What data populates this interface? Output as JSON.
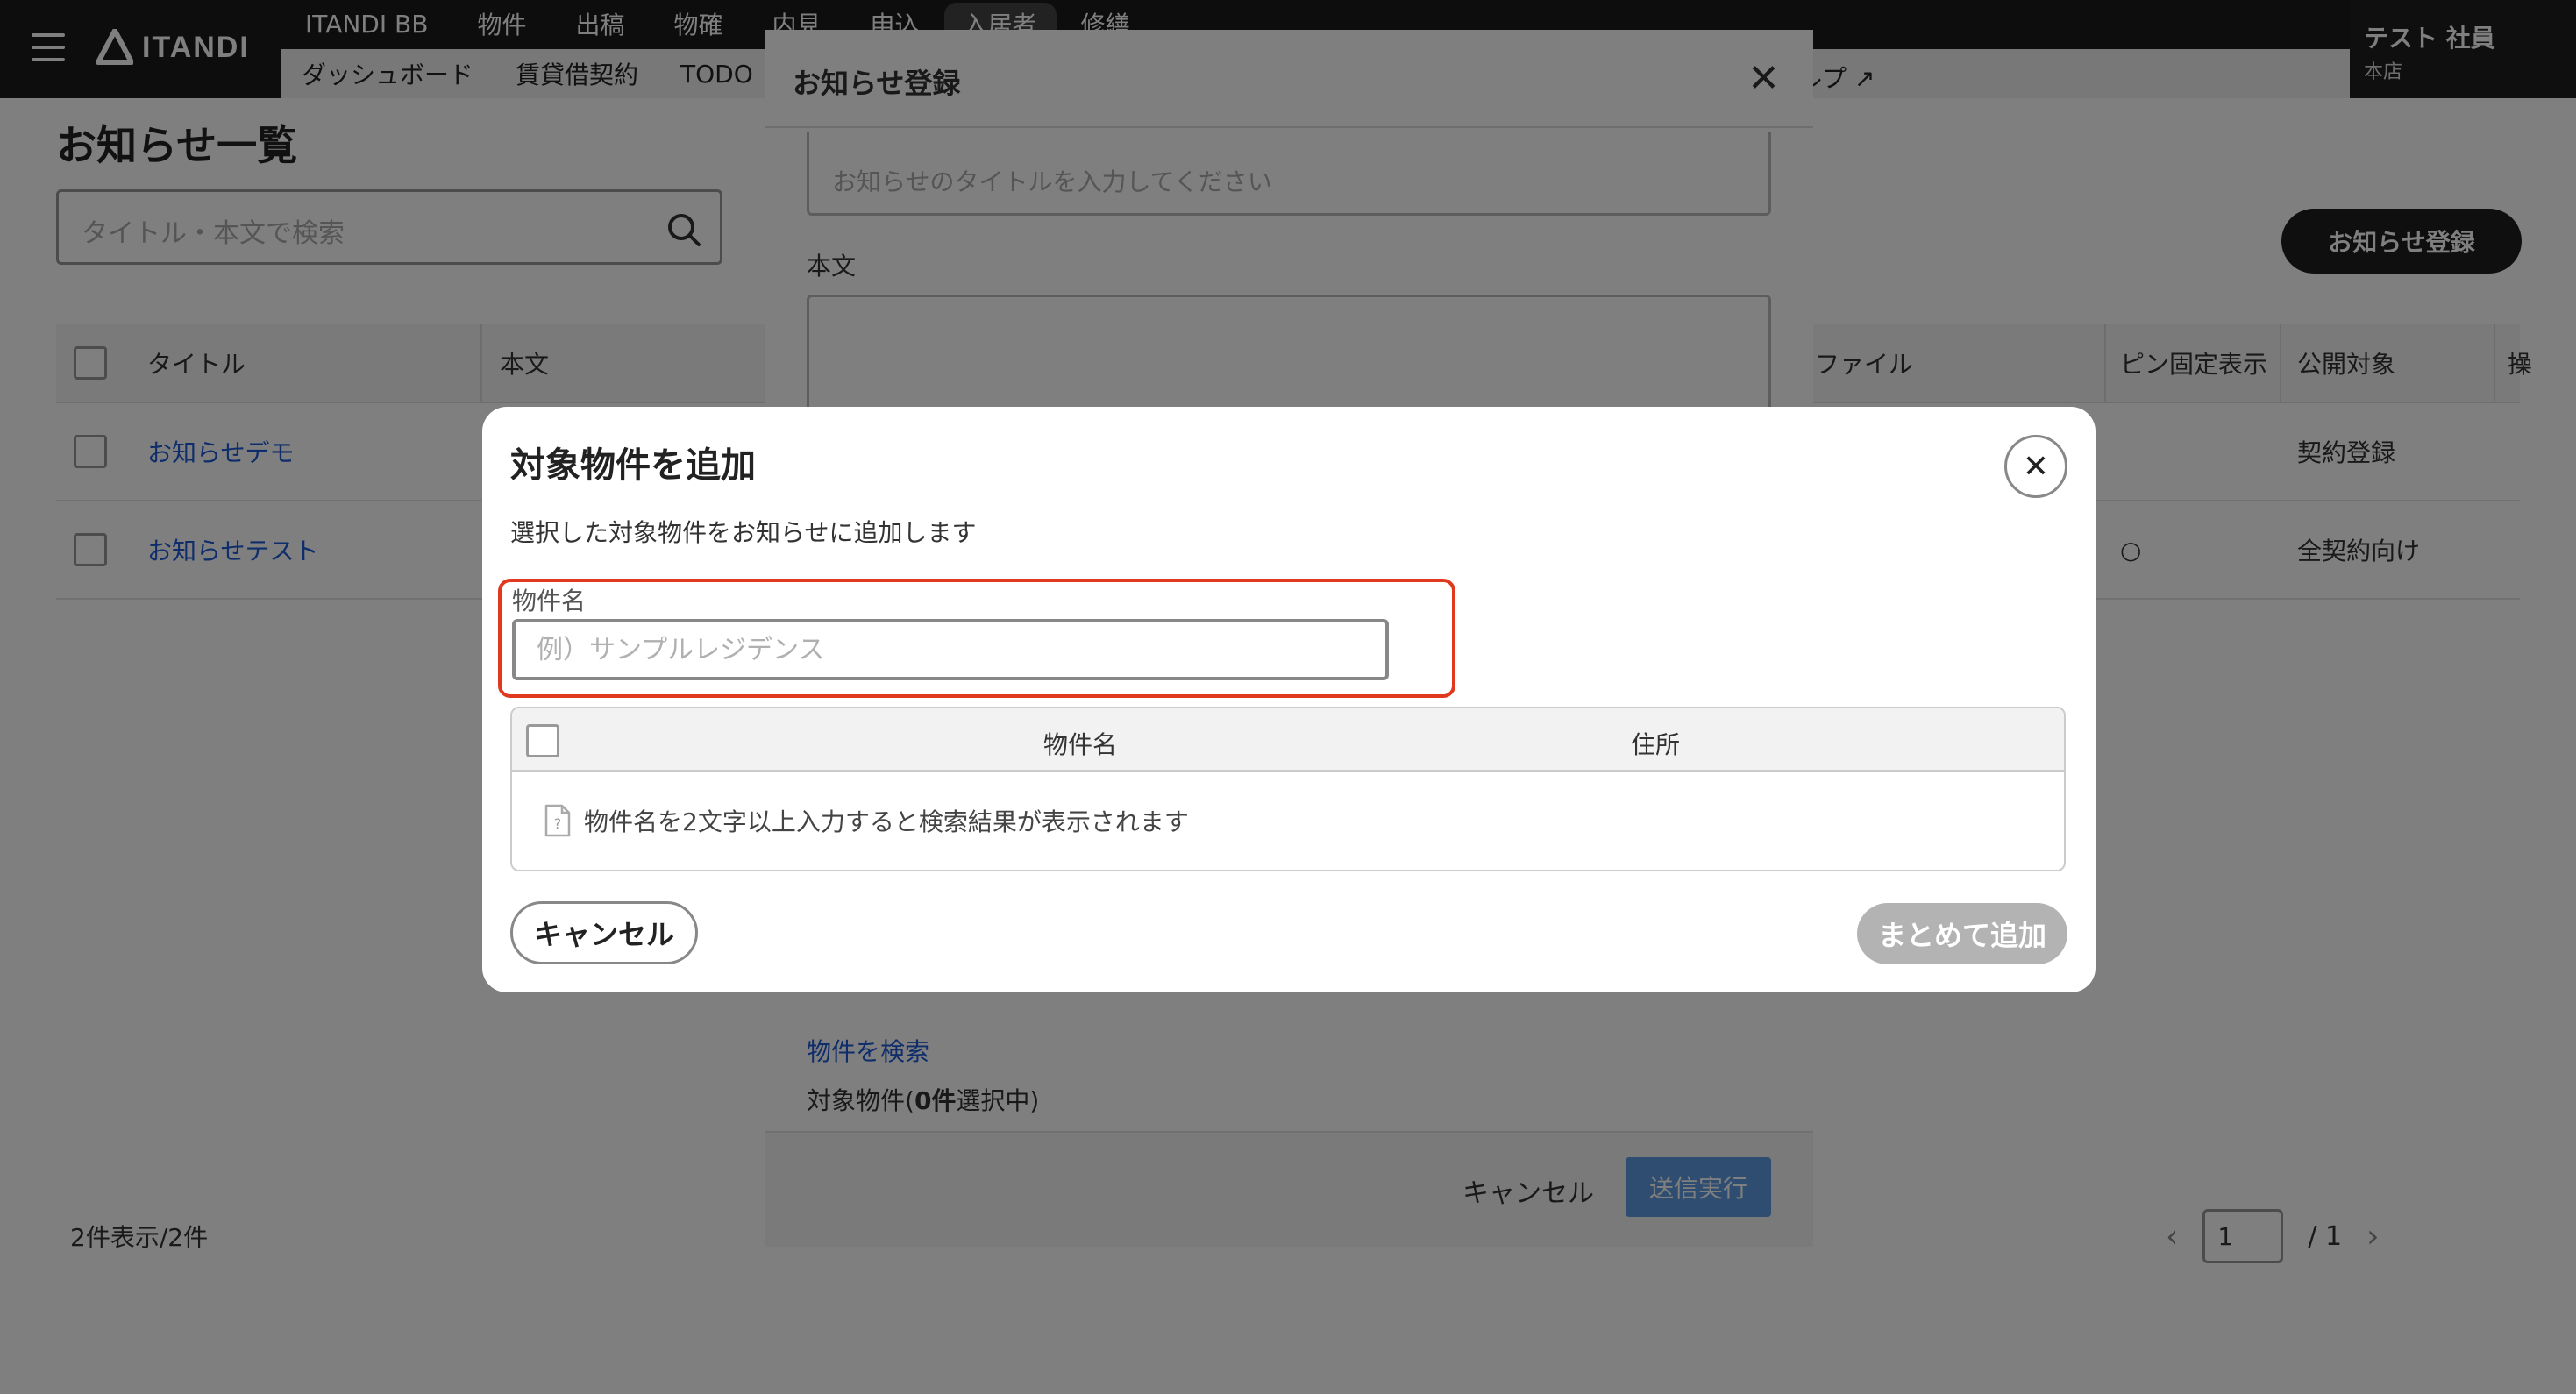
{
  "header": {
    "brand": "ITANDI",
    "nav_primary": [
      "ITANDI BB",
      "物件",
      "出稿",
      "物確",
      "内見",
      "申込",
      "入居者",
      "修繕"
    ],
    "nav_primary_active_index": 6,
    "nav_secondary": [
      "ダッシュボード",
      "賃貸借契約",
      "TODO"
    ],
    "help_label": "ルプ",
    "user_name": "テスト 社員",
    "user_branch": "本店"
  },
  "list_page": {
    "title": "お知らせ一覧",
    "search_placeholder": "タイトル・本文で検索",
    "register_button": "お知らせ登録",
    "columns": {
      "title": "タイトル",
      "body": "本文",
      "file": "ファイル",
      "pin": "ピン固定表示",
      "audience": "公開対象",
      "extra": "操"
    },
    "rows": [
      {
        "title": "お知らせデモ",
        "pin": "",
        "audience": "契約登録"
      },
      {
        "title": "お知らせテスト",
        "pin": "○",
        "audience": "全契約向け"
      }
    ],
    "count_text": "2件表示/2件",
    "pager": {
      "current": "1",
      "total": "/ 1"
    }
  },
  "notice_modal": {
    "title": "お知らせ登録",
    "title_placeholder": "お知らせのタイトルを入力してください",
    "body_label": "本文",
    "search_link": "物件を検索",
    "target_prefix": "対象物件(",
    "target_count": "0件",
    "target_suffix": "選択中)",
    "cancel_label": "キャンセル",
    "submit_label": "送信実行"
  },
  "property_modal": {
    "title": "対象物件を追加",
    "description": "選択した対象物件をお知らせに追加します",
    "field_label": "物件名",
    "field_placeholder": "例）サンプルレジデンス",
    "field_value": "",
    "table_headers": {
      "name": "物件名",
      "address": "住所"
    },
    "empty_message": "物件名を2文字以上入力すると検索結果が表示されます",
    "cancel_label": "キャンセル",
    "add_label": "まとめて追加"
  },
  "colors": {
    "header_bg": "#1a1a1a",
    "link": "#1e5bd6",
    "highlight_border": "#e0391f",
    "disabled_button": "#b3b3b3",
    "submit_button": "#5d9be0"
  }
}
